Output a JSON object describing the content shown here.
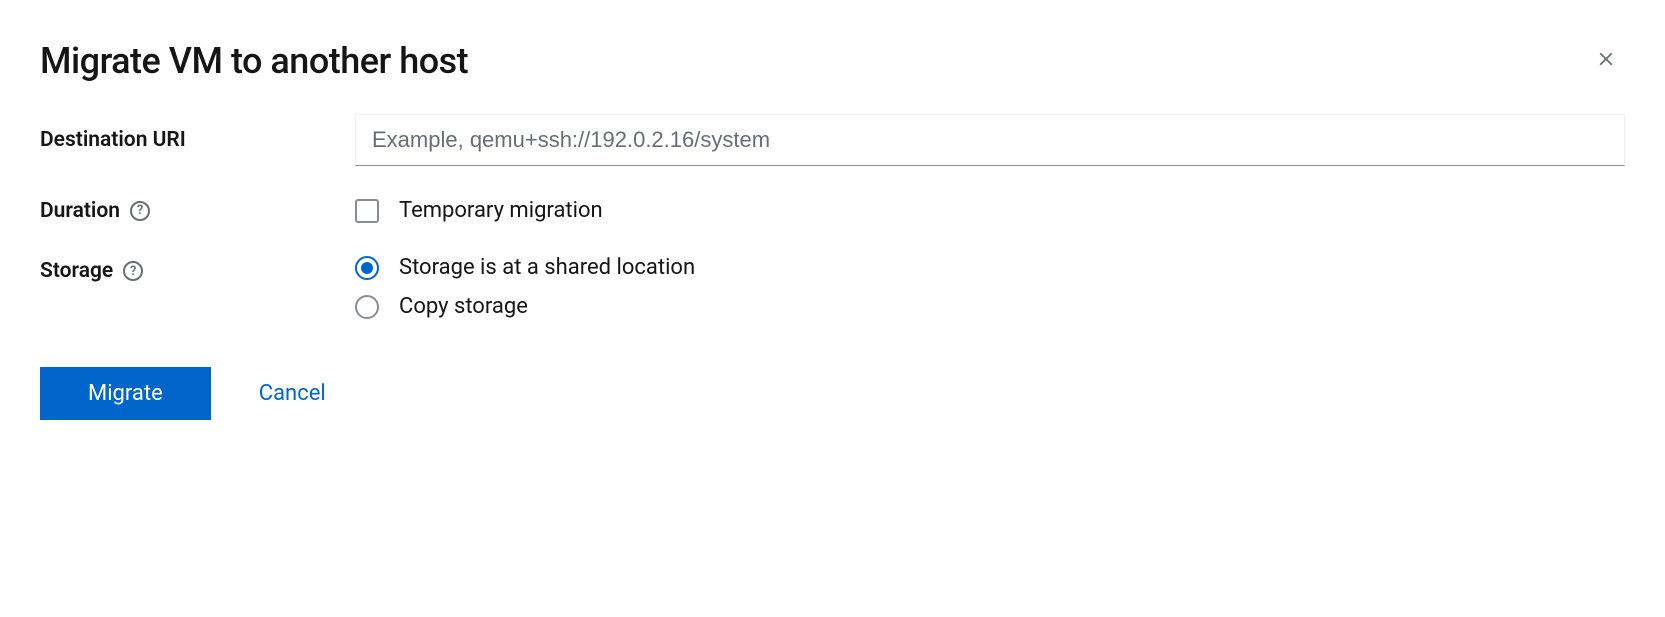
{
  "modal": {
    "title": "Migrate VM to another host"
  },
  "form": {
    "destination": {
      "label": "Destination URI",
      "placeholder": "Example, qemu+ssh://192.0.2.16/system",
      "value": ""
    },
    "duration": {
      "label": "Duration",
      "checkbox_label": "Temporary migration",
      "checked": false
    },
    "storage": {
      "label": "Storage",
      "options": [
        {
          "label": "Storage is at a shared location",
          "selected": true
        },
        {
          "label": "Copy storage",
          "selected": false
        }
      ]
    }
  },
  "actions": {
    "primary": "Migrate",
    "cancel": "Cancel"
  }
}
